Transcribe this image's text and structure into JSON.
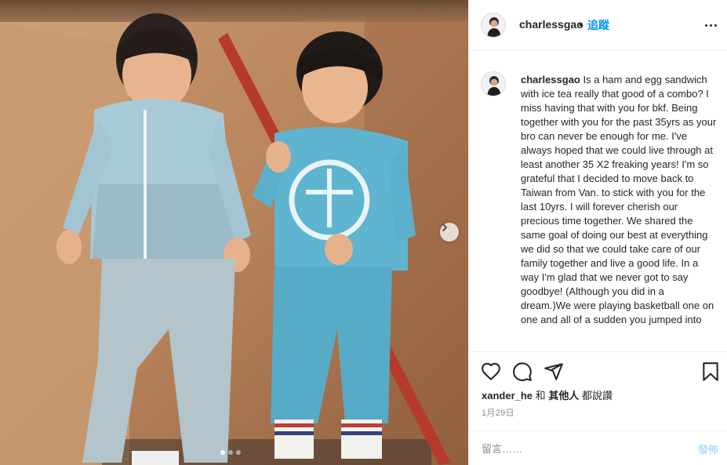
{
  "post": {
    "username": "charlessgao",
    "separator": "•",
    "follow_label": "追蹤",
    "caption_user": "charlessgao",
    "caption_text": "Is a ham and egg sandwich with ice tea really that good of a combo? I miss having that with you for bkf. Being together with you for the past 35yrs as your bro can never be enough for me. I've always hoped that we could live through at least another 35 X2 freaking years! I'm so grateful that I decided to move back to Taiwan from Van. to stick with you for the last 10yrs. I will forever cherish our precious time together. We shared the same goal of doing our best at everything we did so that we could take care of our family together and live a good life. In a way I'm glad that we never got to say goodbye! (Although you did in a dream.)We were playing basketball one on one and all of a sudden you jumped into",
    "likes_user": "xander_he",
    "likes_and": "和",
    "likes_others": "其他人",
    "likes_suffix": "都說讚",
    "date": "1月29日",
    "comment_placeholder": "留言……",
    "post_label": "發佈"
  },
  "carousel": {
    "slide_count": 3,
    "active_index": 0
  },
  "icons": {
    "like": "heart-icon",
    "comment": "comment-icon",
    "share": "share-icon",
    "save": "bookmark-icon",
    "more": "more-icon",
    "next": "chevron-right-icon"
  },
  "colors": {
    "accent": "#0095f6",
    "post_disabled": "#b2dffc",
    "text": "#262626",
    "muted": "#8e8e8e"
  }
}
